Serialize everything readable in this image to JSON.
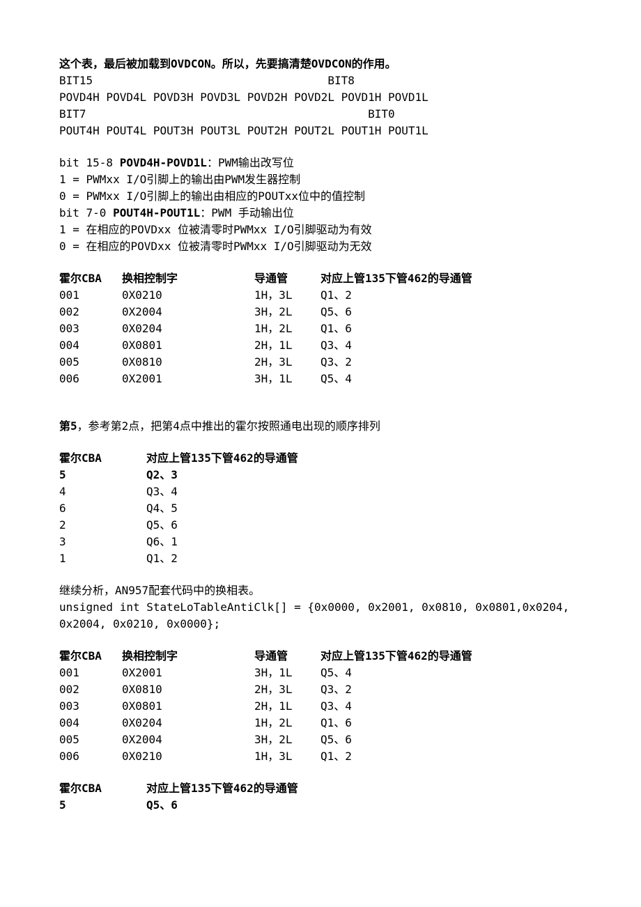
{
  "p1": "这个表，最后被加载到OVDCON。所以，先要搞清楚OVDCON的作用。",
  "reg1": "BIT15                                   BIT8",
  "reg2": "POVD4H POVD4L POVD3H POVD3L POVD2H POVD2L POVD1H POVD1L",
  "reg3": "BIT7                                          BIT0",
  "reg4": "POUT4H POUT4L POUT3H POUT3L POUT2H POUT2L POUT1H POUT1L",
  "b1a": "bit 15-8 ",
  "b1b": "POVD4H-POVD1L",
  "b1c": "：PWM输出改写位",
  "b2": "1 = PWMxx I/O引脚上的输出由PWM发生器控制",
  "b3": "0 = PWMxx I/O引脚上的输出由相应的POUTxx位中的值控制",
  "b4a": "bit 7-0 ",
  "b4b": "POUT4H-POUT1L",
  "b4c": "：PWM 手动输出位",
  "b5": "1 = 在相应的POVDxx 位被清零时PWMxx I/O引脚驱动为有效",
  "b6": "0 = 在相应的POVDxx 位被清零时PWMxx I/O引脚驱动为无效",
  "t1h": {
    "c0": "霍尔CBA",
    "c1": "换相控制字",
    "c2": "导通管",
    "c3": "对应上管135下管462的导通管"
  },
  "t1": [
    {
      "c0": "001",
      "c1": "0X0210",
      "c2": "1H，3L",
      "c3": "Q1、2"
    },
    {
      "c0": "002",
      "c1": "0X2004",
      "c2": "3H，2L",
      "c3": "Q5、6"
    },
    {
      "c0": "003",
      "c1": "0X0204",
      "c2": "1H，2L",
      "c3": "Q1、6"
    },
    {
      "c0": "004",
      "c1": "0X0801",
      "c2": "2H，1L",
      "c3": "Q3、4"
    },
    {
      "c0": "005",
      "c1": "0X0810",
      "c2": "2H，3L",
      "c3": "Q3、2"
    },
    {
      "c0": "006",
      "c1": "0X2001",
      "c2": "3H，1L",
      "c3": "Q5、4"
    }
  ],
  "p5a": "第5",
  "p5b": "，参考第2点，把第4点中推出的霍尔按照通电出现的顺序排列",
  "t2h": {
    "c0": "霍尔CBA",
    "c1": "对应上管135下管462的导通管"
  },
  "t2": [
    {
      "c0": "5",
      "c1": "Q2、3"
    },
    {
      "c0": "4",
      "c1": "Q3、4"
    },
    {
      "c0": "6",
      "c1": "Q4、5"
    },
    {
      "c0": "2",
      "c1": "Q5、6"
    },
    {
      "c0": "3",
      "c1": "Q6、1"
    },
    {
      "c0": "1",
      "c1": "Q1、2"
    }
  ],
  "p6": "继续分析，AN957配套代码中的换相表。",
  "p7": "unsigned int StateLoTableAntiClk[] = {0x0000, 0x2001, 0x0810, 0x0801,0x0204, 0x2004, 0x0210, 0x0000};",
  "t3": [
    {
      "c0": "001",
      "c1": "0X2001",
      "c2": "3H，1L",
      "c3": "Q5、4"
    },
    {
      "c0": "002",
      "c1": "0X0810",
      "c2": "2H，3L",
      "c3": "Q3、2"
    },
    {
      "c0": "003",
      "c1": "0X0801",
      "c2": "2H，1L",
      "c3": "Q3、4"
    },
    {
      "c0": "004",
      "c1": "0X0204",
      "c2": "1H，2L",
      "c3": "Q1、6"
    },
    {
      "c0": "005",
      "c1": "0X2004",
      "c2": "3H，2L",
      "c3": "Q5、6"
    },
    {
      "c0": "006",
      "c1": "0X0210",
      "c2": "1H，3L",
      "c3": "Q1、2"
    }
  ],
  "t4": [
    {
      "c0": "5",
      "c1": "Q5、6"
    }
  ]
}
